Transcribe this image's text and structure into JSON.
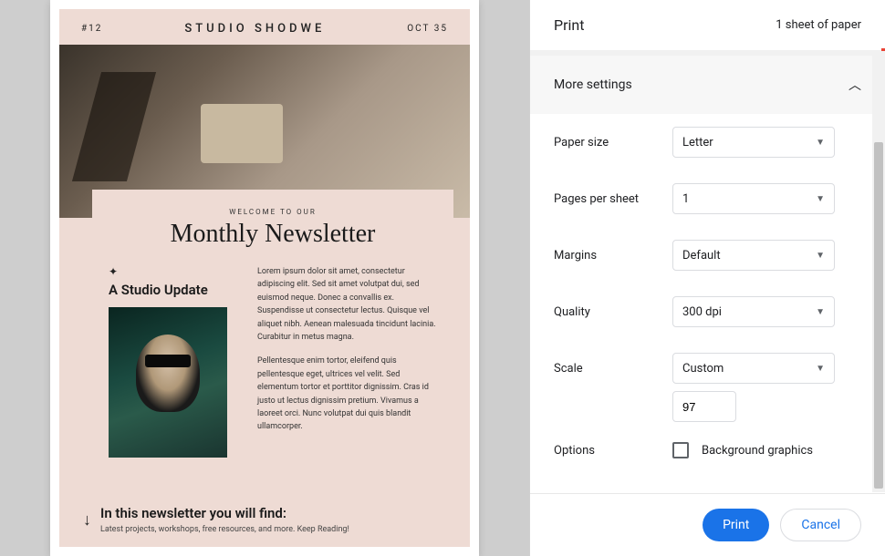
{
  "preview": {
    "issue": "#12",
    "brand": "STUDIO SHODWE",
    "date": "OCT 35",
    "welcome": "WELCOME TO OUR",
    "title": "Monthly Newsletter",
    "subtitle": "A Studio Update",
    "para1": "Lorem ipsum dolor sit amet, consectetur adipiscing elit. Sed sit amet volutpat dui, sed euismod neque. Donec a convallis ex. Suspendisse ut consectetur lectus. Quisque vel aliquet nibh. Aenean malesuada tincidunt lacinia. Curabitur in metus magna.",
    "para2": "Pellentesque enim tortor, eleifend quis pellentesque eget, ultrices vel velit. Sed elementum tortor et porttitor dignissim. Cras id justo ut lectus dignissim pretium. Vivamus a laoreet orci. Nunc volutpat dui quis blandit ullamcorper.",
    "footer_heading": "In this newsletter you will find:",
    "footer_sub": "Latest projects, workshops, free resources, and more. Keep Reading!"
  },
  "dialog": {
    "title": "Print",
    "sheets": "1 sheet of paper",
    "more_settings": "More settings",
    "labels": {
      "paper_size": "Paper size",
      "pages_per_sheet": "Pages per sheet",
      "margins": "Margins",
      "quality": "Quality",
      "scale": "Scale",
      "options": "Options"
    },
    "values": {
      "paper_size": "Letter",
      "pages_per_sheet": "1",
      "margins": "Default",
      "quality": "300 dpi",
      "scale": "Custom",
      "scale_value": "97",
      "bg_graphics": "Background graphics"
    },
    "buttons": {
      "print": "Print",
      "cancel": "Cancel"
    }
  }
}
